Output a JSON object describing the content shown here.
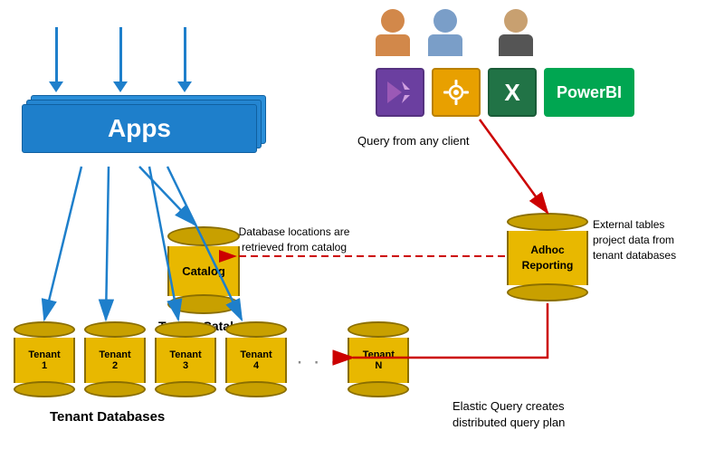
{
  "apps": {
    "label": "Apps"
  },
  "catalog": {
    "label": "Catalog",
    "sub_label": "Tenant Catalog"
  },
  "tenants": [
    {
      "label": "Tenant\n1"
    },
    {
      "label": "Tenant\n2"
    },
    {
      "label": "Tenant\n3"
    },
    {
      "label": "Tenant\n4"
    },
    {
      "label": "Tenant\nN"
    }
  ],
  "tenant_databases_label": "Tenant Databases",
  "adhoc": {
    "label": "Adhoc\nReporting"
  },
  "annotations": {
    "query_from_client": "Query from any client",
    "db_locations": "Database locations are\nretrieved from catalog",
    "external_tables": "External tables\nproject data from\ntenant databases",
    "elastic_query": "Elastic Query creates\ndistributed query plan"
  },
  "tools": [
    {
      "name": "Visual Studio",
      "symbol": "VS",
      "class": "tool-vs"
    },
    {
      "name": "SSMS",
      "symbol": "🔧",
      "class": "tool-ssms"
    },
    {
      "name": "Excel",
      "symbol": "X",
      "class": "tool-excel"
    }
  ],
  "powerbi_label": "PowerBI",
  "colors": {
    "blue_arrow": "#1e7fcb",
    "red_arrow": "#cc0000",
    "dashed_arrow": "#cc0000",
    "cylinder_gold": "#e8b800",
    "cylinder_border": "#8a6e00"
  }
}
